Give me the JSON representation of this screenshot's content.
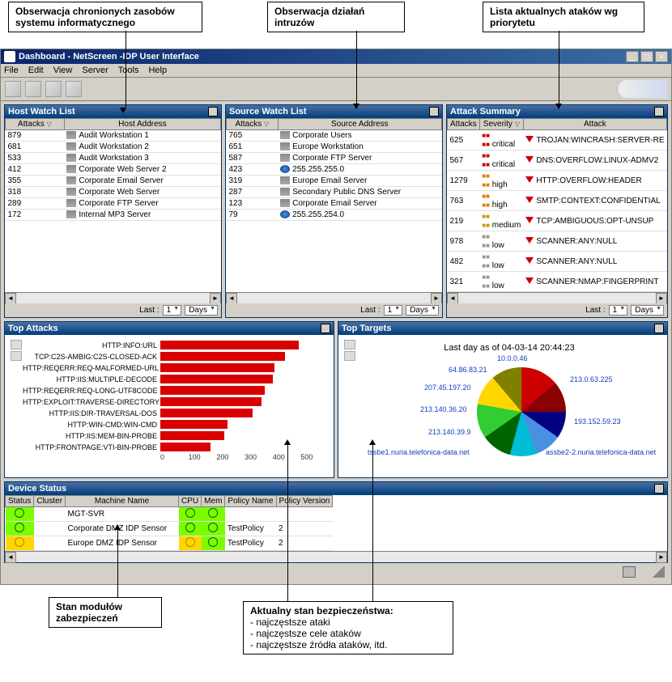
{
  "annotations": {
    "top_left": "Obserwacja chronionych zasobów systemu informatycznego",
    "top_mid": "Obserwacja działań intruzów",
    "top_right": "Lista aktualnych ataków wg priorytetu",
    "bottom_left": "Stan modułów zabezpieczeń",
    "bottom_mid_title": "Aktualny stan bezpieczeństwa:",
    "bottom_mid_1": "- najczęstsze ataki",
    "bottom_mid_2": "- najczęstsze cele ataków",
    "bottom_mid_3": "- najczęstsze źródła ataków, itd."
  },
  "window": {
    "title": "Dashboard - NetScreen -IDP User Interface",
    "menu": [
      "File",
      "Edit",
      "View",
      "Server",
      "Tools",
      "Help"
    ]
  },
  "host_watch": {
    "title": "Host Watch List",
    "cols": [
      "Attacks",
      "Host Address"
    ],
    "rows": [
      {
        "attacks": "879",
        "host": "Audit Workstation 1"
      },
      {
        "attacks": "681",
        "host": "Audit Workstation 2"
      },
      {
        "attacks": "533",
        "host": "Audit Workstation 3"
      },
      {
        "attacks": "412",
        "host": "Corporate Web Server 2"
      },
      {
        "attacks": "355",
        "host": "Corporate Email Server"
      },
      {
        "attacks": "318",
        "host": "Corporate Web Server"
      },
      {
        "attacks": "289",
        "host": "Corporate FTP Server"
      },
      {
        "attacks": "172",
        "host": "Internal MP3 Server"
      }
    ],
    "footer": {
      "label": "Last :",
      "num": "1",
      "unit": "Days"
    }
  },
  "source_watch": {
    "title": "Source Watch List",
    "cols": [
      "Attacks",
      "Source Address"
    ],
    "rows": [
      {
        "attacks": "765",
        "host": "Corporate Users"
      },
      {
        "attacks": "651",
        "host": "Europe Workstation"
      },
      {
        "attacks": "587",
        "host": "Corporate FTP Server"
      },
      {
        "attacks": "423",
        "host": "255.255.255.0"
      },
      {
        "attacks": "319",
        "host": "Europe Email Server"
      },
      {
        "attacks": "287",
        "host": "Secondary Public DNS Server"
      },
      {
        "attacks": "123",
        "host": "Corporate Email Server"
      },
      {
        "attacks": "79",
        "host": "255.255.254.0"
      }
    ],
    "footer": {
      "label": "Last :",
      "num": "1",
      "unit": "Days"
    }
  },
  "attack_summary": {
    "title": "Attack Summary",
    "cols": [
      "Attacks",
      "Severity",
      "Attack"
    ],
    "rows": [
      {
        "attacks": "625",
        "sev": "critical",
        "name": "TROJAN:WINCRASH:SERVER-RE"
      },
      {
        "attacks": "567",
        "sev": "critical",
        "name": "DNS:OVERFLOW:LINUX-ADMV2"
      },
      {
        "attacks": "1279",
        "sev": "high",
        "name": "HTTP:OVERFLOW:HEADER"
      },
      {
        "attacks": "763",
        "sev": "high",
        "name": "SMTP:CONTEXT:CONFIDENTIAL"
      },
      {
        "attacks": "219",
        "sev": "medium",
        "name": "TCP:AMBIGUOUS:OPT-UNSUP"
      },
      {
        "attacks": "978",
        "sev": "low",
        "name": "SCANNER:ANY:NULL"
      },
      {
        "attacks": "482",
        "sev": "low",
        "name": "SCANNER:ANY:NULL"
      },
      {
        "attacks": "321",
        "sev": "low",
        "name": "SCANNER:NMAP:FINGERPRINT"
      }
    ],
    "footer": {
      "label": "Last :",
      "num": "1",
      "unit": "Days"
    }
  },
  "top_attacks": {
    "title": "Top Attacks"
  },
  "top_targets": {
    "title": "Top Targets",
    "subtitle": "Last day as of 04-03-14 20:44:23"
  },
  "device_status": {
    "title": "Device Status",
    "cols": [
      "Status",
      "Cluster",
      "Machine Name",
      "CPU",
      "Mem",
      "Policy Name",
      "Policy Version"
    ],
    "rows": [
      {
        "status": "green",
        "cluster": "",
        "machine": "MGT-SVR",
        "cpu": "green",
        "mem": "green",
        "policy": "",
        "ver": ""
      },
      {
        "status": "green",
        "cluster": "",
        "machine": "Corporate DMZ IDP Sensor",
        "cpu": "green",
        "mem": "green",
        "policy": "TestPolicy",
        "ver": "2"
      },
      {
        "status": "yellow",
        "cluster": "",
        "machine": "Europe DMZ IDP Sensor",
        "cpu": "yellow",
        "mem": "green",
        "policy": "TestPolicy",
        "ver": "2"
      }
    ]
  },
  "chart_data": [
    {
      "type": "bar",
      "title": "Top Attacks",
      "xlabel": "",
      "ylabel": "",
      "xlim": [
        0,
        500
      ],
      "xticks": [
        0,
        100,
        200,
        300,
        400,
        500
      ],
      "categories": [
        "HTTP:INFO:URL",
        "TCP:C2S-AMBIG:C2S-CLOSED-ACK",
        "HTTP:REQERR:REQ-MALFORMED-URL",
        "HTTP:IIS:MULTIPLE-DECODE",
        "HTTP:REQERR:REQ-LONG-UTF8CODE",
        "HTTP:EXPLOIT:TRAVERSE-DIRECTORY",
        "HTTP:IIS:DIR-TRAVERSAL-DOS",
        "HTTP:WIN-CMD:WIN-CMD",
        "HTTP:IIS:MEM-BIN-PROBE",
        "HTTP:FRONTPAGE:VTI-BIN-PROBE"
      ],
      "values": [
        410,
        370,
        340,
        335,
        310,
        300,
        275,
        200,
        190,
        150
      ]
    },
    {
      "type": "pie",
      "title": "Top Targets",
      "subtitle": "Last day as of 04-03-14 20:44:23",
      "slices": [
        {
          "label": "213.0.63.225",
          "value": 14
        },
        {
          "label": "193.152.59.23",
          "value": 11
        },
        {
          "label": "assbe2-2.nuria.telefonica-data.net",
          "value": 12
        },
        {
          "label": "tssbe1.nuria.telefonica-data.net",
          "value": 11
        },
        {
          "label": "213.140.39.9",
          "value": 10
        },
        {
          "label": "213.140.36.20",
          "value": 10
        },
        {
          "label": "207.45.197.20",
          "value": 10
        },
        {
          "label": "64.86.83.21",
          "value": 11
        },
        {
          "label": "10.0.0.46",
          "value": 11
        }
      ]
    }
  ]
}
